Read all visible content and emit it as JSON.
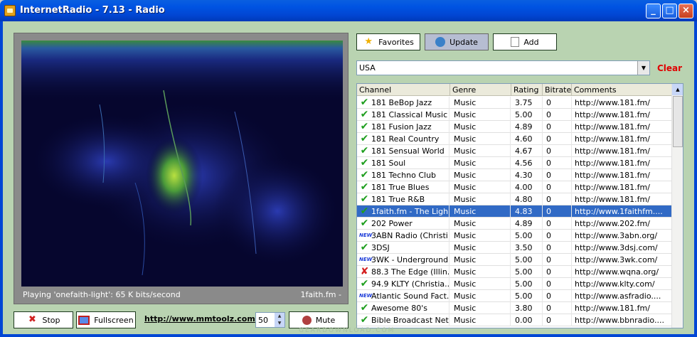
{
  "window": {
    "title": "InternetRadio - 7.13 - Radio",
    "controls": [
      "_",
      "□",
      "×"
    ]
  },
  "player": {
    "status_left": "Playing 'onefaith-light': 65 K bits/second",
    "status_right": "1faith.fm -",
    "stop_label": "Stop",
    "fullscreen_label": "Fullscreen",
    "website_link": "http://www.mmtoolz.com",
    "volume": "50",
    "mute_label": "Mute"
  },
  "toolbar": {
    "favorites_label": "Favorites",
    "update_label": "Update",
    "add_label": "Add"
  },
  "filter": {
    "country": "USA",
    "clear_label": "Clear"
  },
  "table": {
    "columns": [
      "Channel",
      "Genre",
      "Rating",
      "Bitrate",
      "Comments"
    ],
    "rows": [
      {
        "status": "ok",
        "channel": "181 BeBop Jazz",
        "genre": "Music",
        "rating": "3.75",
        "bitrate": "0",
        "comments": "http://www.181.fm/"
      },
      {
        "status": "ok",
        "channel": "181 Classical Music",
        "genre": "Music",
        "rating": "5.00",
        "bitrate": "0",
        "comments": "http://www.181.fm/"
      },
      {
        "status": "ok",
        "channel": "181 Fusion Jazz",
        "genre": "Music",
        "rating": "4.89",
        "bitrate": "0",
        "comments": "http://www.181.fm/"
      },
      {
        "status": "ok",
        "channel": "181 Real Country",
        "genre": "Music",
        "rating": "4.60",
        "bitrate": "0",
        "comments": "http://www.181.fm/"
      },
      {
        "status": "ok",
        "channel": "181 Sensual World",
        "genre": "Music",
        "rating": "4.67",
        "bitrate": "0",
        "comments": "http://www.181.fm/"
      },
      {
        "status": "ok",
        "channel": "181 Soul",
        "genre": "Music",
        "rating": "4.56",
        "bitrate": "0",
        "comments": "http://www.181.fm/"
      },
      {
        "status": "ok",
        "channel": "181 Techno Club",
        "genre": "Music",
        "rating": "4.30",
        "bitrate": "0",
        "comments": "http://www.181.fm/"
      },
      {
        "status": "ok",
        "channel": "181 True Blues",
        "genre": "Music",
        "rating": "4.00",
        "bitrate": "0",
        "comments": "http://www.181.fm/"
      },
      {
        "status": "ok",
        "channel": "181 True R&B",
        "genre": "Music",
        "rating": "4.80",
        "bitrate": "0",
        "comments": "http://www.181.fm/"
      },
      {
        "status": "ok",
        "channel": "1faith.fm - The Ligh...",
        "genre": "Music",
        "rating": "4.83",
        "bitrate": "0",
        "comments": "http://www.1faithfm....",
        "selected": true
      },
      {
        "status": "ok",
        "channel": "202 Power",
        "genre": "Music",
        "rating": "4.89",
        "bitrate": "0",
        "comments": "http://www.202.fm/"
      },
      {
        "status": "new",
        "channel": "3ABN Radio (Christi...",
        "genre": "Music",
        "rating": "5.00",
        "bitrate": "0",
        "comments": "http://www.3abn.org/"
      },
      {
        "status": "ok",
        "channel": "3DSJ",
        "genre": "Music",
        "rating": "3.50",
        "bitrate": "0",
        "comments": "http://www.3dsj.com/"
      },
      {
        "status": "new",
        "channel": "3WK - Underground...",
        "genre": "Music",
        "rating": "5.00",
        "bitrate": "0",
        "comments": "http://www.3wk.com/"
      },
      {
        "status": "bad",
        "channel": "88.3 The Edge (Illin...",
        "genre": "Music",
        "rating": "5.00",
        "bitrate": "0",
        "comments": "http://www.wqna.org/"
      },
      {
        "status": "ok",
        "channel": "94.9 KLTY (Christia...",
        "genre": "Music",
        "rating": "5.00",
        "bitrate": "0",
        "comments": "http://www.klty.com/"
      },
      {
        "status": "new",
        "channel": "Atlantic Sound Fact...",
        "genre": "Music",
        "rating": "5.00",
        "bitrate": "0",
        "comments": "http://www.asfradio...."
      },
      {
        "status": "ok",
        "channel": "Awesome 80's",
        "genre": "Music",
        "rating": "3.80",
        "bitrate": "0",
        "comments": "http://www.181.fm/"
      },
      {
        "status": "ok",
        "channel": "Bible Broadcast Net...",
        "genre": "Music",
        "rating": "0.00",
        "bitrate": "0",
        "comments": "http://www.bbnradio...."
      }
    ]
  },
  "status_glyphs": {
    "ok": "✔",
    "bad": "✘",
    "new": "NEW"
  },
  "watermark": "GEARDOWNLOAD.COM"
}
